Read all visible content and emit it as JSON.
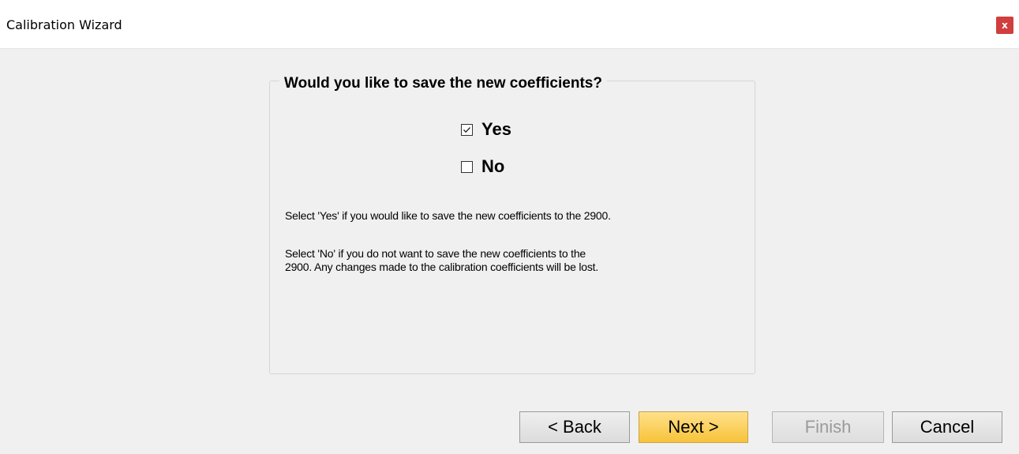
{
  "window": {
    "title": "Calibration Wizard",
    "close_label": "x"
  },
  "question": {
    "heading": "Would you like to save the new coefficients?",
    "options": [
      {
        "label": "Yes",
        "checked": true
      },
      {
        "label": "No",
        "checked": false
      }
    ],
    "note_yes": "Select 'Yes' if you would like to save the new coefficients to the 2900.",
    "note_no_line1": "Select 'No' if you do not want to save the new coefficients to the",
    "note_no_line2": "2900.  Any changes made to the calibration coefficients will be lost."
  },
  "buttons": {
    "back": "< Back",
    "next": "Next >",
    "finish": "Finish",
    "cancel": "Cancel"
  },
  "colors": {
    "close_button": "#d03e3e",
    "next_highlight": "#f7c33a",
    "disabled_text": "#9a9a9a"
  },
  "icons": {
    "checkbox_checked": "checkbox-checked-icon",
    "checkbox_unchecked": "checkbox-unchecked-icon"
  }
}
